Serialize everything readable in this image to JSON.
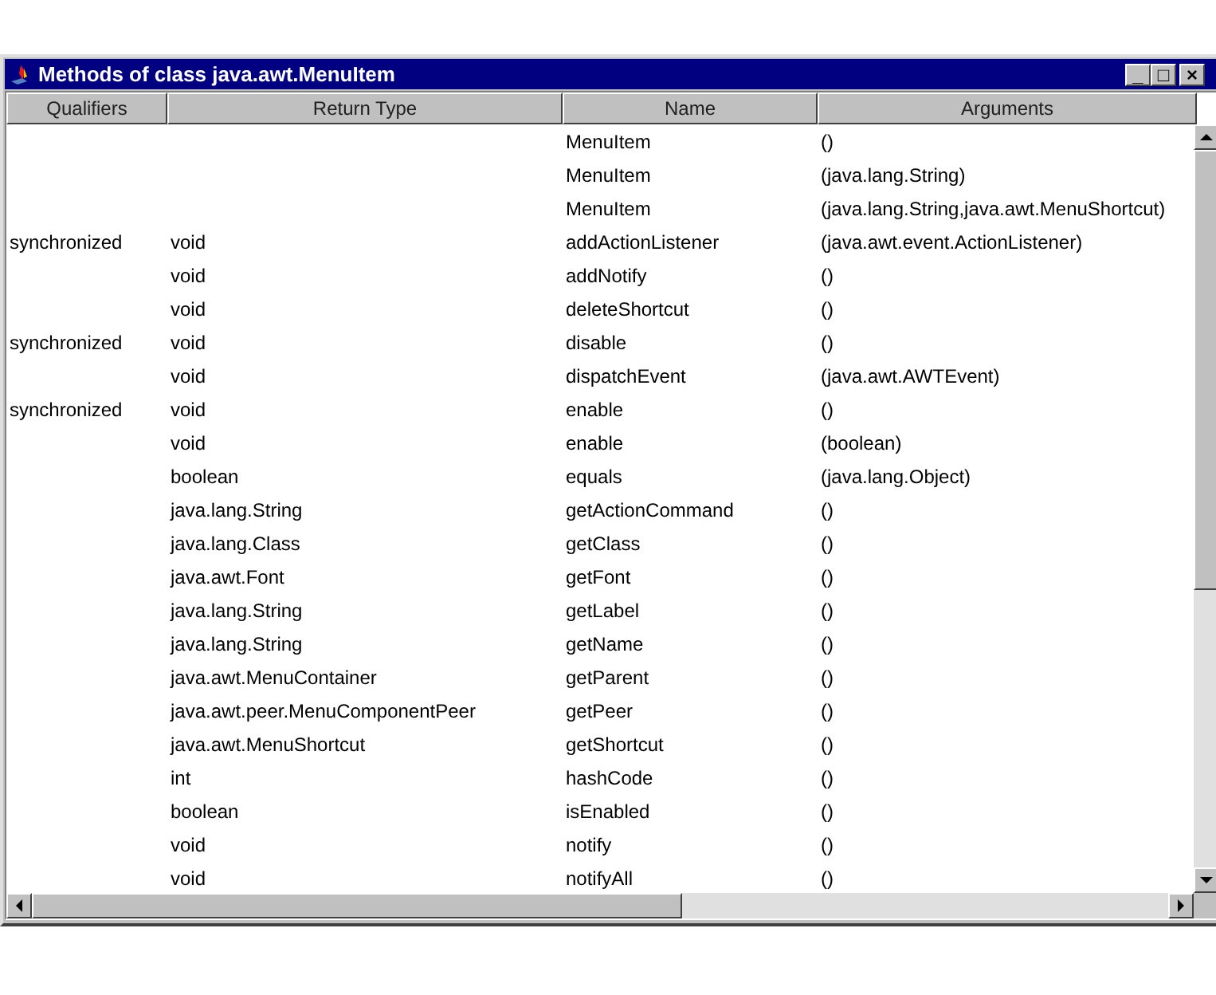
{
  "window": {
    "title": "Methods of class java.awt.MenuItem",
    "controls": [
      "_",
      "□",
      "×"
    ]
  },
  "table": {
    "columns": [
      "Qualifiers",
      "Return Type",
      "Name",
      "Arguments"
    ],
    "rows": [
      [
        "",
        "",
        "MenuItem",
        "()"
      ],
      [
        "",
        "",
        "MenuItem",
        "(java.lang.String)"
      ],
      [
        "",
        "",
        "MenuItem",
        "(java.lang.String,java.awt.MenuShortcut)"
      ],
      [
        "synchronized",
        "void",
        "addActionListener",
        "(java.awt.event.ActionListener)"
      ],
      [
        "",
        "void",
        "addNotify",
        "()"
      ],
      [
        "",
        "void",
        "deleteShortcut",
        "()"
      ],
      [
        "synchronized",
        "void",
        "disable",
        "()"
      ],
      [
        "",
        "void",
        "dispatchEvent",
        "(java.awt.AWTEvent)"
      ],
      [
        "synchronized",
        "void",
        "enable",
        "()"
      ],
      [
        "",
        "void",
        "enable",
        "(boolean)"
      ],
      [
        "",
        "boolean",
        "equals",
        "(java.lang.Object)"
      ],
      [
        "",
        "java.lang.String",
        "getActionCommand",
        "()"
      ],
      [
        "",
        "java.lang.Class",
        "getClass",
        "()"
      ],
      [
        "",
        "java.awt.Font",
        "getFont",
        "()"
      ],
      [
        "",
        "java.lang.String",
        "getLabel",
        "()"
      ],
      [
        "",
        "java.lang.String",
        "getName",
        "()"
      ],
      [
        "",
        "java.awt.MenuContainer",
        "getParent",
        "()"
      ],
      [
        "",
        "java.awt.peer.MenuComponentPeer",
        "getPeer",
        "()"
      ],
      [
        "",
        "java.awt.MenuShortcut",
        "getShortcut",
        "()"
      ],
      [
        "",
        "int",
        "hashCode",
        "()"
      ],
      [
        "",
        "boolean",
        "isEnabled",
        "()"
      ],
      [
        "",
        "void",
        "notify",
        "()"
      ],
      [
        "",
        "void",
        "notifyAll",
        "()"
      ]
    ]
  }
}
